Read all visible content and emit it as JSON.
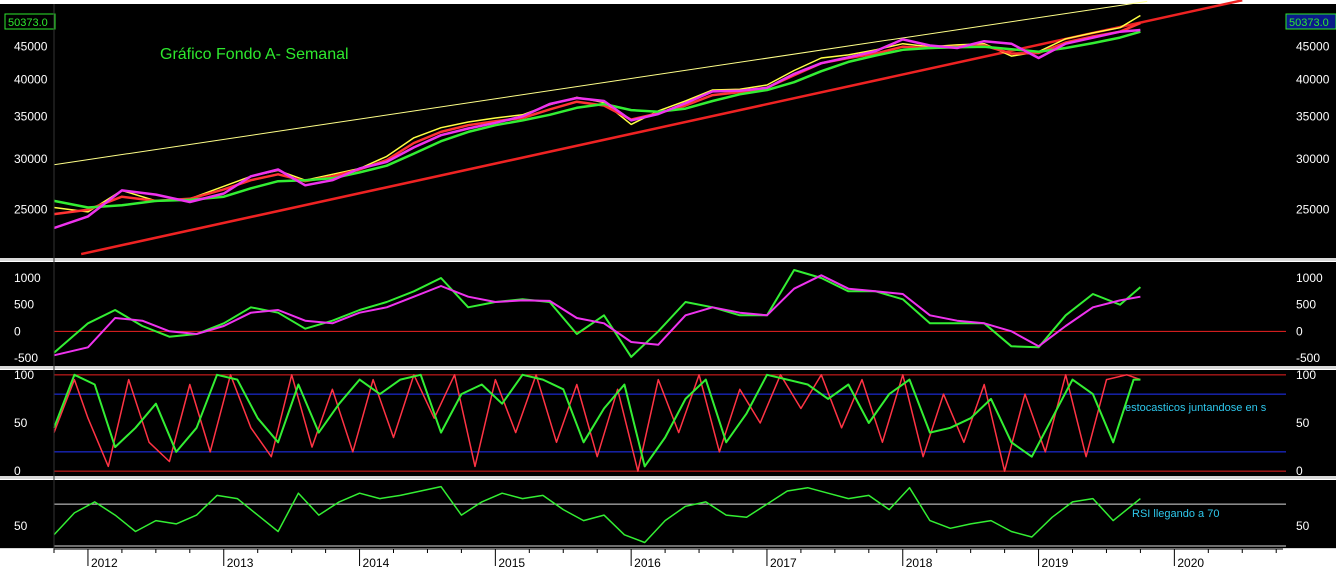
{
  "chart_data": [
    {
      "type": "line",
      "panel": "price",
      "title": "Gráfico Fondo A- Semanal",
      "last_value_label": "50373.0",
      "ylim": [
        21000,
        52500
      ],
      "y_scale": "log",
      "y_ticks": [
        "25000",
        "30000",
        "35000",
        "40000",
        "45000"
      ],
      "xlim": [
        2011.75,
        2020.8
      ],
      "series": [
        {
          "color": "#ffff44",
          "x": [
            2011.75,
            2012.0,
            2012.25,
            2012.5,
            2012.75,
            2013.0,
            2013.2,
            2013.4,
            2013.6,
            2013.8,
            2014.0,
            2014.2,
            2014.4,
            2014.6,
            2014.8,
            2015.0,
            2015.2,
            2015.4,
            2015.6,
            2015.8,
            2016.0,
            2016.2,
            2016.4,
            2016.6,
            2016.8,
            2017.0,
            2017.2,
            2017.4,
            2017.6,
            2017.8,
            2018.0,
            2018.2,
            2018.4,
            2018.6,
            2018.8,
            2019.0,
            2019.2,
            2019.4,
            2019.6,
            2019.75
          ],
          "values": [
            25200,
            24800,
            26800,
            25800,
            26000,
            27200,
            28200,
            28800,
            27800,
            28400,
            29000,
            30300,
            32400,
            33600,
            34300,
            34800,
            35200,
            36500,
            37500,
            36800,
            34000,
            35700,
            37000,
            38500,
            38600,
            39200,
            41300,
            43200,
            43700,
            44500,
            45500,
            45000,
            45300,
            45500,
            43500,
            44200,
            46300,
            47300,
            48200,
            50373
          ]
        },
        {
          "color": "#ff3333",
          "x": [
            2011.75,
            2012.0,
            2012.25,
            2012.5,
            2012.75,
            2013.0,
            2013.2,
            2013.4,
            2013.6,
            2013.8,
            2014.0,
            2014.2,
            2014.4,
            2014.6,
            2014.8,
            2015.0,
            2015.2,
            2015.4,
            2015.6,
            2015.8,
            2016.0,
            2016.2,
            2016.4,
            2016.6,
            2016.8,
            2017.0,
            2017.2,
            2017.4,
            2017.6,
            2017.8,
            2018.0,
            2018.2,
            2018.4,
            2018.6,
            2018.8,
            2019.0,
            2019.2,
            2019.4,
            2019.6,
            2019.75
          ],
          "values": [
            24600,
            25000,
            26200,
            25800,
            26000,
            26900,
            27800,
            28400,
            27700,
            28200,
            28900,
            29900,
            31800,
            33100,
            33900,
            34400,
            34800,
            35900,
            36900,
            36400,
            34600,
            35400,
            36400,
            37800,
            38200,
            38800,
            40600,
            42400,
            43200,
            43900,
            45000,
            44800,
            45000,
            45200,
            43900,
            44000,
            45700,
            46700,
            47500,
            49000
          ]
        },
        {
          "color": "#33ee33",
          "x": [
            2011.75,
            2012.0,
            2012.25,
            2012.5,
            2012.75,
            2013.0,
            2013.2,
            2013.4,
            2013.6,
            2013.8,
            2014.0,
            2014.2,
            2014.4,
            2014.6,
            2014.8,
            2015.0,
            2015.2,
            2015.4,
            2015.6,
            2015.8,
            2016.0,
            2016.2,
            2016.4,
            2016.6,
            2016.8,
            2017.0,
            2017.2,
            2017.4,
            2017.6,
            2017.8,
            2018.0,
            2018.2,
            2018.4,
            2018.6,
            2018.8,
            2019.0,
            2019.2,
            2019.4,
            2019.6,
            2019.75
          ],
          "values": [
            25800,
            25200,
            25400,
            25800,
            25900,
            26200,
            27000,
            27700,
            27800,
            28000,
            28600,
            29300,
            30600,
            32000,
            33100,
            33900,
            34500,
            35200,
            36100,
            36600,
            35800,
            35600,
            36000,
            37000,
            37900,
            38500,
            39600,
            41200,
            42600,
            43600,
            44500,
            44800,
            44900,
            45000,
            44600,
            44200,
            44800,
            45600,
            46500,
            47500
          ]
        },
        {
          "color": "#ee33ee",
          "x": [
            2011.75,
            2012.0,
            2012.25,
            2012.5,
            2012.75,
            2013.0,
            2013.2,
            2013.4,
            2013.6,
            2013.8,
            2014.0,
            2014.2,
            2014.4,
            2014.6,
            2014.8,
            2015.0,
            2015.2,
            2015.4,
            2015.6,
            2015.8,
            2016.0,
            2016.2,
            2016.4,
            2016.6,
            2016.8,
            2017.0,
            2017.2,
            2017.4,
            2017.6,
            2017.8,
            2018.0,
            2018.2,
            2018.4,
            2018.6,
            2018.8,
            2019.0,
            2019.2,
            2019.4,
            2019.6,
            2019.75
          ],
          "values": [
            23400,
            24400,
            26800,
            26400,
            25700,
            26500,
            28200,
            28900,
            27300,
            27800,
            29000,
            29700,
            31300,
            32700,
            33500,
            34200,
            35000,
            36600,
            37400,
            37000,
            34500,
            35300,
            36700,
            38300,
            38400,
            38800,
            40800,
            42400,
            43300,
            44300,
            46200,
            45200,
            44800,
            45900,
            45500,
            43200,
            45500,
            46500,
            47500,
            47800
          ]
        }
      ],
      "trendlines": [
        {
          "color": "#ffff88",
          "x": [
            2011.75,
            2019.8
          ],
          "values": [
            29400,
            53000
          ]
        },
        {
          "color": "#ee2222",
          "x": [
            2011.95,
            2020.5
          ],
          "values": [
            21300,
            53200
          ]
        }
      ]
    },
    {
      "type": "line",
      "panel": "macd",
      "ylim": [
        -650,
        1300
      ],
      "y_ticks": [
        "1000",
        "500",
        "0",
        "-500"
      ],
      "zero_line": 0,
      "series": [
        {
          "color": "#33ee33",
          "x": [
            2011.75,
            2012.0,
            2012.2,
            2012.4,
            2012.6,
            2012.8,
            2013.0,
            2013.2,
            2013.4,
            2013.6,
            2013.8,
            2014.0,
            2014.2,
            2014.4,
            2014.6,
            2014.8,
            2015.0,
            2015.2,
            2015.4,
            2015.6,
            2015.8,
            2016.0,
            2016.2,
            2016.4,
            2016.6,
            2016.8,
            2017.0,
            2017.2,
            2017.4,
            2017.6,
            2017.8,
            2018.0,
            2018.2,
            2018.4,
            2018.6,
            2018.8,
            2019.0,
            2019.2,
            2019.4,
            2019.6,
            2019.75
          ],
          "values": [
            -400,
            150,
            400,
            100,
            -100,
            -50,
            150,
            450,
            350,
            50,
            200,
            400,
            550,
            750,
            1000,
            450,
            550,
            600,
            550,
            -50,
            300,
            -480,
            0,
            550,
            450,
            300,
            300,
            1150,
            1000,
            750,
            750,
            600,
            150,
            150,
            150,
            -280,
            -300,
            300,
            700,
            500,
            830
          ]
        },
        {
          "color": "#ee33ee",
          "x": [
            2011.75,
            2012.0,
            2012.2,
            2012.4,
            2012.6,
            2012.8,
            2013.0,
            2013.2,
            2013.4,
            2013.6,
            2013.8,
            2014.0,
            2014.2,
            2014.4,
            2014.6,
            2014.8,
            2015.0,
            2015.2,
            2015.4,
            2015.6,
            2015.8,
            2016.0,
            2016.2,
            2016.4,
            2016.6,
            2016.8,
            2017.0,
            2017.2,
            2017.4,
            2017.6,
            2017.8,
            2018.0,
            2018.2,
            2018.4,
            2018.6,
            2018.8,
            2019.0,
            2019.2,
            2019.4,
            2019.6,
            2019.75
          ],
          "values": [
            -450,
            -300,
            250,
            200,
            0,
            -50,
            100,
            350,
            400,
            200,
            150,
            350,
            450,
            650,
            850,
            650,
            550,
            580,
            570,
            250,
            150,
            -200,
            -250,
            300,
            450,
            350,
            300,
            800,
            1050,
            800,
            750,
            700,
            300,
            200,
            150,
            0,
            -280,
            100,
            450,
            580,
            650
          ]
        }
      ]
    },
    {
      "type": "line",
      "panel": "stochastic",
      "ylim": [
        -5,
        105
      ],
      "y_ticks": [
        "100",
        "50",
        "0"
      ],
      "reference_lines": [
        100,
        80,
        20,
        0
      ],
      "annotation": "estocasticos juntandose en s",
      "series": [
        {
          "color": "#ff3344",
          "x": [
            2011.75,
            2011.9,
            2012.0,
            2012.15,
            2012.3,
            2012.45,
            2012.6,
            2012.75,
            2012.9,
            2013.05,
            2013.2,
            2013.35,
            2013.5,
            2013.65,
            2013.8,
            2013.95,
            2014.1,
            2014.25,
            2014.4,
            2014.55,
            2014.7,
            2014.85,
            2015.0,
            2015.15,
            2015.3,
            2015.45,
            2015.6,
            2015.75,
            2015.9,
            2016.05,
            2016.2,
            2016.35,
            2016.5,
            2016.65,
            2016.8,
            2016.95,
            2017.1,
            2017.25,
            2017.4,
            2017.55,
            2017.7,
            2017.85,
            2018.0,
            2018.15,
            2018.3,
            2018.45,
            2018.6,
            2018.75,
            2018.9,
            2019.05,
            2019.2,
            2019.35,
            2019.5,
            2019.65,
            2019.75
          ],
          "values": [
            40,
            95,
            55,
            5,
            95,
            30,
            10,
            90,
            20,
            100,
            45,
            15,
            100,
            25,
            85,
            20,
            95,
            35,
            100,
            55,
            100,
            5,
            95,
            40,
            100,
            30,
            90,
            15,
            85,
            0,
            95,
            40,
            100,
            20,
            85,
            50,
            100,
            65,
            100,
            45,
            95,
            30,
            100,
            15,
            80,
            30,
            90,
            0,
            80,
            20,
            100,
            15,
            95,
            100,
            95
          ]
        },
        {
          "color": "#33ee33",
          "x": [
            2011.75,
            2011.9,
            2012.05,
            2012.2,
            2012.35,
            2012.5,
            2012.65,
            2012.8,
            2012.95,
            2013.1,
            2013.25,
            2013.4,
            2013.55,
            2013.7,
            2013.85,
            2014.0,
            2014.15,
            2014.3,
            2014.45,
            2014.6,
            2014.75,
            2014.9,
            2015.05,
            2015.2,
            2015.35,
            2015.5,
            2015.65,
            2015.8,
            2015.95,
            2016.1,
            2016.25,
            2016.4,
            2016.55,
            2016.7,
            2016.85,
            2017.0,
            2017.15,
            2017.3,
            2017.45,
            2017.6,
            2017.75,
            2017.9,
            2018.05,
            2018.2,
            2018.35,
            2018.5,
            2018.65,
            2018.8,
            2018.95,
            2019.1,
            2019.25,
            2019.4,
            2019.55,
            2019.7,
            2019.75
          ],
          "values": [
            45,
            100,
            90,
            25,
            45,
            70,
            20,
            45,
            100,
            95,
            55,
            30,
            90,
            40,
            70,
            95,
            80,
            95,
            100,
            40,
            80,
            90,
            70,
            100,
            95,
            85,
            30,
            65,
            90,
            5,
            35,
            75,
            95,
            30,
            60,
            100,
            95,
            90,
            75,
            90,
            50,
            80,
            95,
            40,
            45,
            55,
            75,
            30,
            15,
            55,
            95,
            80,
            30,
            95,
            95
          ]
        }
      ]
    },
    {
      "type": "line",
      "panel": "rsi",
      "ylim": [
        30,
        92
      ],
      "y_ticks": [
        "50"
      ],
      "reference_lines": [
        70
      ],
      "annotation": "RSI llegando a 70",
      "x_ticks": [
        "2012",
        "2013",
        "2014",
        "2015",
        "2016",
        "2017",
        "2018",
        "2019",
        "2020"
      ],
      "series": [
        {
          "color": "#33ee33",
          "x": [
            2011.75,
            2011.9,
            2012.05,
            2012.2,
            2012.35,
            2012.5,
            2012.65,
            2012.8,
            2012.95,
            2013.1,
            2013.25,
            2013.4,
            2013.55,
            2013.7,
            2013.85,
            2014.0,
            2014.15,
            2014.3,
            2014.45,
            2014.6,
            2014.75,
            2014.9,
            2015.05,
            2015.2,
            2015.35,
            2015.5,
            2015.65,
            2015.8,
            2015.95,
            2016.1,
            2016.25,
            2016.4,
            2016.55,
            2016.7,
            2016.85,
            2017.0,
            2017.15,
            2017.3,
            2017.45,
            2017.6,
            2017.75,
            2017.9,
            2018.05,
            2018.2,
            2018.35,
            2018.5,
            2018.65,
            2018.8,
            2018.95,
            2019.1,
            2019.25,
            2019.4,
            2019.55,
            2019.7,
            2019.75
          ],
          "values": [
            42,
            62,
            72,
            60,
            45,
            55,
            52,
            60,
            78,
            75,
            60,
            45,
            80,
            60,
            72,
            80,
            75,
            78,
            82,
            86,
            60,
            72,
            80,
            75,
            78,
            65,
            55,
            60,
            42,
            35,
            55,
            68,
            72,
            60,
            58,
            70,
            82,
            85,
            80,
            75,
            78,
            65,
            85,
            55,
            48,
            52,
            55,
            45,
            40,
            58,
            72,
            75,
            55,
            70,
            75
          ]
        }
      ]
    }
  ]
}
